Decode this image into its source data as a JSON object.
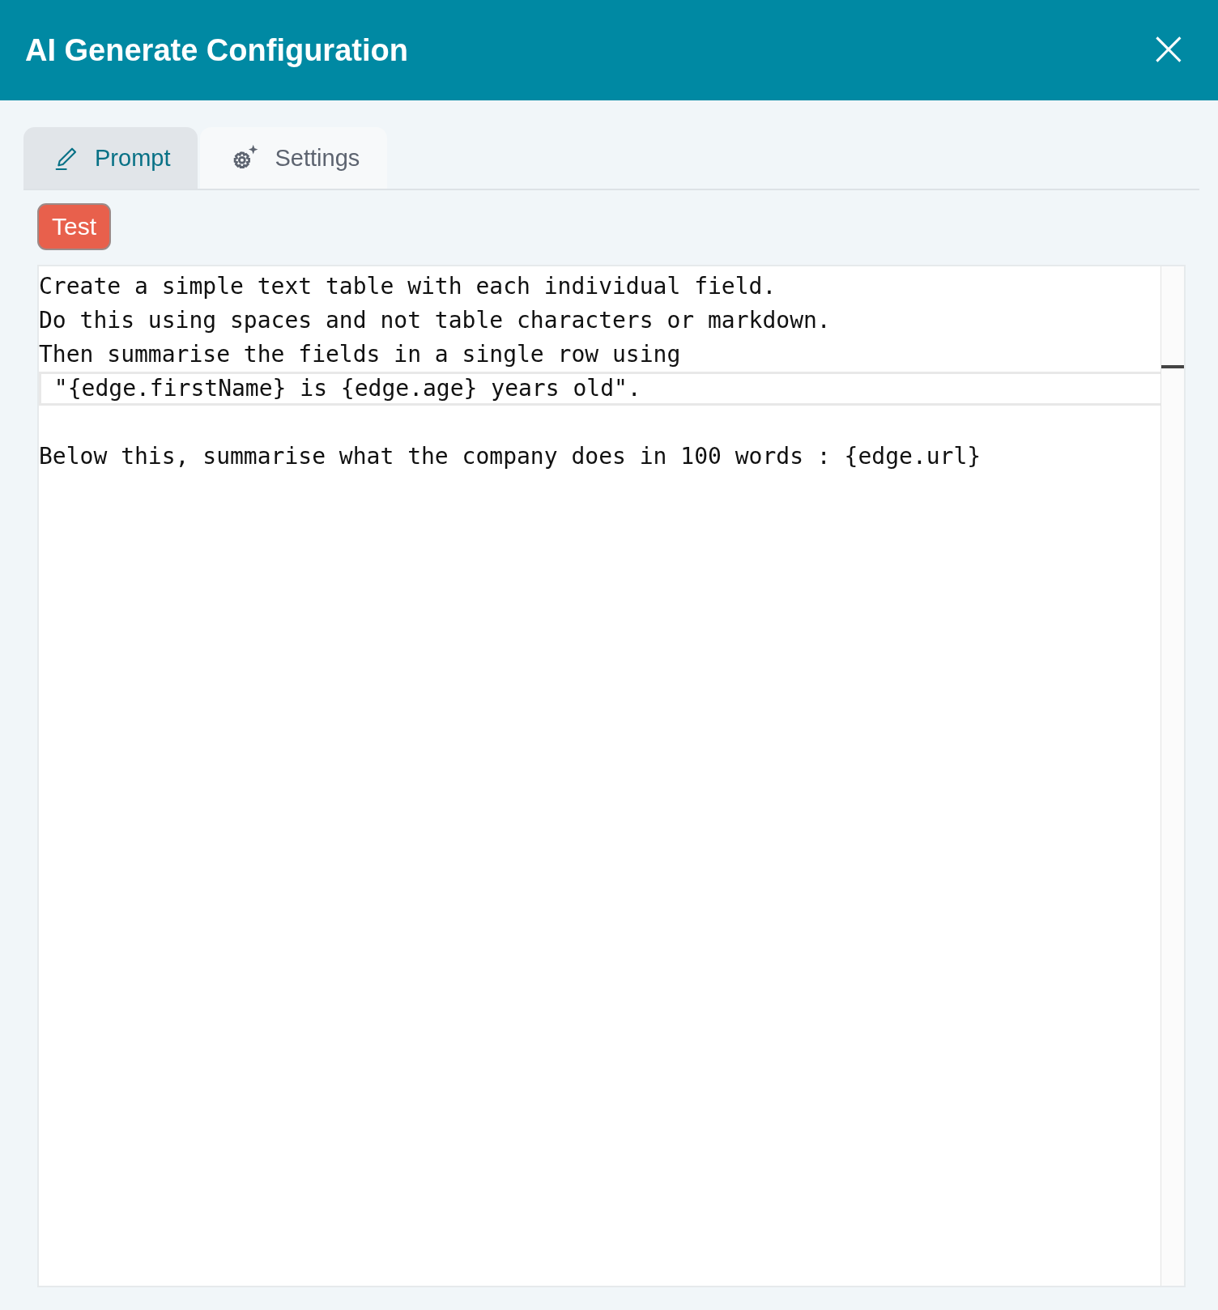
{
  "window": {
    "title": "AI Generate Configuration",
    "close": "×"
  },
  "tabs": [
    {
      "label": "Prompt",
      "selected": true
    },
    {
      "label": "Settings",
      "selected": false
    }
  ],
  "test_button": "Test",
  "editor": {
    "lines": [
      {
        "kind": "text",
        "text": "Create a simple text table with each individual field.",
        "active": false
      },
      {
        "kind": "text",
        "text": "Do this using spaces and not table characters or markdown.",
        "active": false
      },
      {
        "kind": "text",
        "text": "Then summarise the fields in a single row using",
        "active": false
      },
      {
        "kind": "text",
        "text": " \"{edge.firstName} is {edge.age} years old\".",
        "active": true
      },
      {
        "kind": "blank"
      },
      {
        "kind": "text",
        "text": "Below this, summarise what the company does in 100 words : {edge.url}",
        "active": false
      }
    ]
  }
}
